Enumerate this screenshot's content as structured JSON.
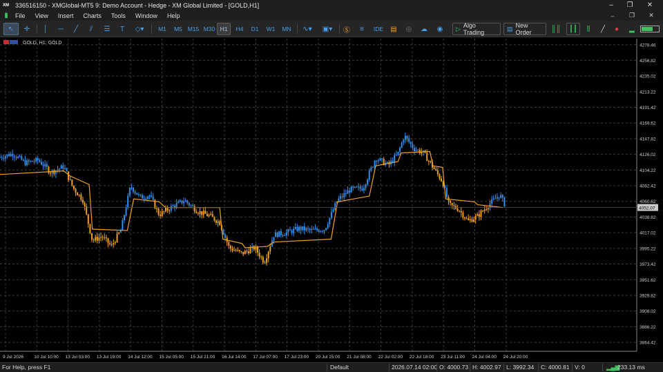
{
  "window": {
    "title": "336516150 - XMGlobal-MT5 9: Demo Account - Hedge - XM Global Limited - [GOLD,H1]",
    "app_icon": "XM"
  },
  "menu": [
    "File",
    "View",
    "Insert",
    "Charts",
    "Tools",
    "Window",
    "Help"
  ],
  "toolbar": {
    "timeframes": [
      "M1",
      "M5",
      "M15",
      "M30",
      "H1",
      "H4",
      "D1",
      "W1",
      "MN"
    ],
    "active_timeframe": "H1",
    "ide_label": "IDE",
    "algo_trading_label": "Algo Trading",
    "new_order_label": "New Order"
  },
  "chart": {
    "label": "GOLD, H1: GOLD",
    "symbol": "GOLD",
    "timeframe": "H1",
    "current_price": "4052.07",
    "colors": {
      "up": "#2f8ff0",
      "down": "#f0a020",
      "grid": "#3c3c3c",
      "price_tag": "#c8c8c8"
    }
  },
  "chart_data": {
    "type": "candlestick",
    "y_ticks": [
      "4278.46",
      "4256.82",
      "4235.02",
      "4213.22",
      "4191.42",
      "4169.62",
      "4147.82",
      "4126.02",
      "4104.22",
      "4082.42",
      "4060.62",
      "4038.82",
      "4017.02",
      "3995.22",
      "3973.42",
      "3951.62",
      "3929.82",
      "3908.02",
      "3886.22",
      "3864.42"
    ],
    "x_ticks": [
      "9 Jul 2026",
      "10 Jul 10:00",
      "13 Jul 03:00",
      "13 Jul 19:00",
      "14 Jul 12:00",
      "15 Jul 05:00",
      "15 Jul 21:00",
      "16 Jul 14:00",
      "17 Jul 07:00",
      "17 Jul 23:00",
      "20 Jul 15:00",
      "21 Jul 08:00",
      "22 Jul 02:00",
      "22 Jul 18:00",
      "23 Jul 11:00",
      "24 Jul 04:00",
      "24 Jul 20:00"
    ],
    "ylim": [
      3852,
      4287
    ],
    "trend_line": [
      {
        "x": 0,
        "y": 4098
      },
      {
        "x": 0.1,
        "y": 4103
      },
      {
        "x": 0.11,
        "y": 4096
      },
      {
        "x": 0.14,
        "y": 4084
      },
      {
        "x": 0.145,
        "y": 4022
      },
      {
        "x": 0.2,
        "y": 4020
      },
      {
        "x": 0.21,
        "y": 4064
      },
      {
        "x": 0.25,
        "y": 4060
      },
      {
        "x": 0.26,
        "y": 4052
      },
      {
        "x": 0.345,
        "y": 4052
      },
      {
        "x": 0.35,
        "y": 4008
      },
      {
        "x": 0.38,
        "y": 4002
      },
      {
        "x": 0.385,
        "y": 3996
      },
      {
        "x": 0.42,
        "y": 3998
      },
      {
        "x": 0.43,
        "y": 4004
      },
      {
        "x": 0.52,
        "y": 4008
      },
      {
        "x": 0.53,
        "y": 4060
      },
      {
        "x": 0.58,
        "y": 4068
      },
      {
        "x": 0.59,
        "y": 4110
      },
      {
        "x": 0.625,
        "y": 4116
      },
      {
        "x": 0.63,
        "y": 4128
      },
      {
        "x": 0.675,
        "y": 4130
      },
      {
        "x": 0.68,
        "y": 4110
      },
      {
        "x": 0.695,
        "y": 4108
      },
      {
        "x": 0.7,
        "y": 4064
      },
      {
        "x": 0.745,
        "y": 4060
      },
      {
        "x": 0.75,
        "y": 4056
      },
      {
        "x": 0.79,
        "y": 4052
      }
    ],
    "price_path": [
      {
        "x": 0,
        "y": 4122
      },
      {
        "x": 0.02,
        "y": 4127
      },
      {
        "x": 0.04,
        "y": 4114
      },
      {
        "x": 0.06,
        "y": 4118
      },
      {
        "x": 0.08,
        "y": 4101
      },
      {
        "x": 0.1,
        "y": 4109
      },
      {
        "x": 0.115,
        "y": 4079
      },
      {
        "x": 0.13,
        "y": 4063
      },
      {
        "x": 0.145,
        "y": 4006
      },
      {
        "x": 0.16,
        "y": 4012
      },
      {
        "x": 0.175,
        "y": 3998
      },
      {
        "x": 0.19,
        "y": 4021
      },
      {
        "x": 0.205,
        "y": 4082
      },
      {
        "x": 0.22,
        "y": 4066
      },
      {
        "x": 0.235,
        "y": 4069
      },
      {
        "x": 0.25,
        "y": 4042
      },
      {
        "x": 0.27,
        "y": 4053
      },
      {
        "x": 0.29,
        "y": 4062
      },
      {
        "x": 0.31,
        "y": 4047
      },
      {
        "x": 0.33,
        "y": 4040
      },
      {
        "x": 0.345,
        "y": 4031
      },
      {
        "x": 0.36,
        "y": 3996
      },
      {
        "x": 0.38,
        "y": 3988
      },
      {
        "x": 0.4,
        "y": 3996
      },
      {
        "x": 0.415,
        "y": 3976
      },
      {
        "x": 0.43,
        "y": 4014
      },
      {
        "x": 0.45,
        "y": 4017
      },
      {
        "x": 0.47,
        "y": 4023
      },
      {
        "x": 0.49,
        "y": 4020
      },
      {
        "x": 0.51,
        "y": 4022
      },
      {
        "x": 0.53,
        "y": 4062
      },
      {
        "x": 0.55,
        "y": 4077
      },
      {
        "x": 0.57,
        "y": 4079
      },
      {
        "x": 0.59,
        "y": 4121
      },
      {
        "x": 0.61,
        "y": 4111
      },
      {
        "x": 0.625,
        "y": 4127
      },
      {
        "x": 0.635,
        "y": 4152
      },
      {
        "x": 0.65,
        "y": 4134
      },
      {
        "x": 0.665,
        "y": 4128
      },
      {
        "x": 0.68,
        "y": 4108
      },
      {
        "x": 0.695,
        "y": 4088
      },
      {
        "x": 0.705,
        "y": 4056
      },
      {
        "x": 0.72,
        "y": 4050
      },
      {
        "x": 0.735,
        "y": 4033
      },
      {
        "x": 0.75,
        "y": 4040
      },
      {
        "x": 0.77,
        "y": 4058
      },
      {
        "x": 0.785,
        "y": 4070
      },
      {
        "x": 0.795,
        "y": 4052
      }
    ]
  },
  "status": {
    "help": "For Help, press F1",
    "profile": "Default",
    "datetime": "2026.07.14 02:00",
    "open": "O: 4000.73",
    "high": "H: 4002.97",
    "low": "L: 3992.34",
    "close": "C: 4000.81",
    "volume": "V: 0",
    "ping": "233.13 ms"
  }
}
